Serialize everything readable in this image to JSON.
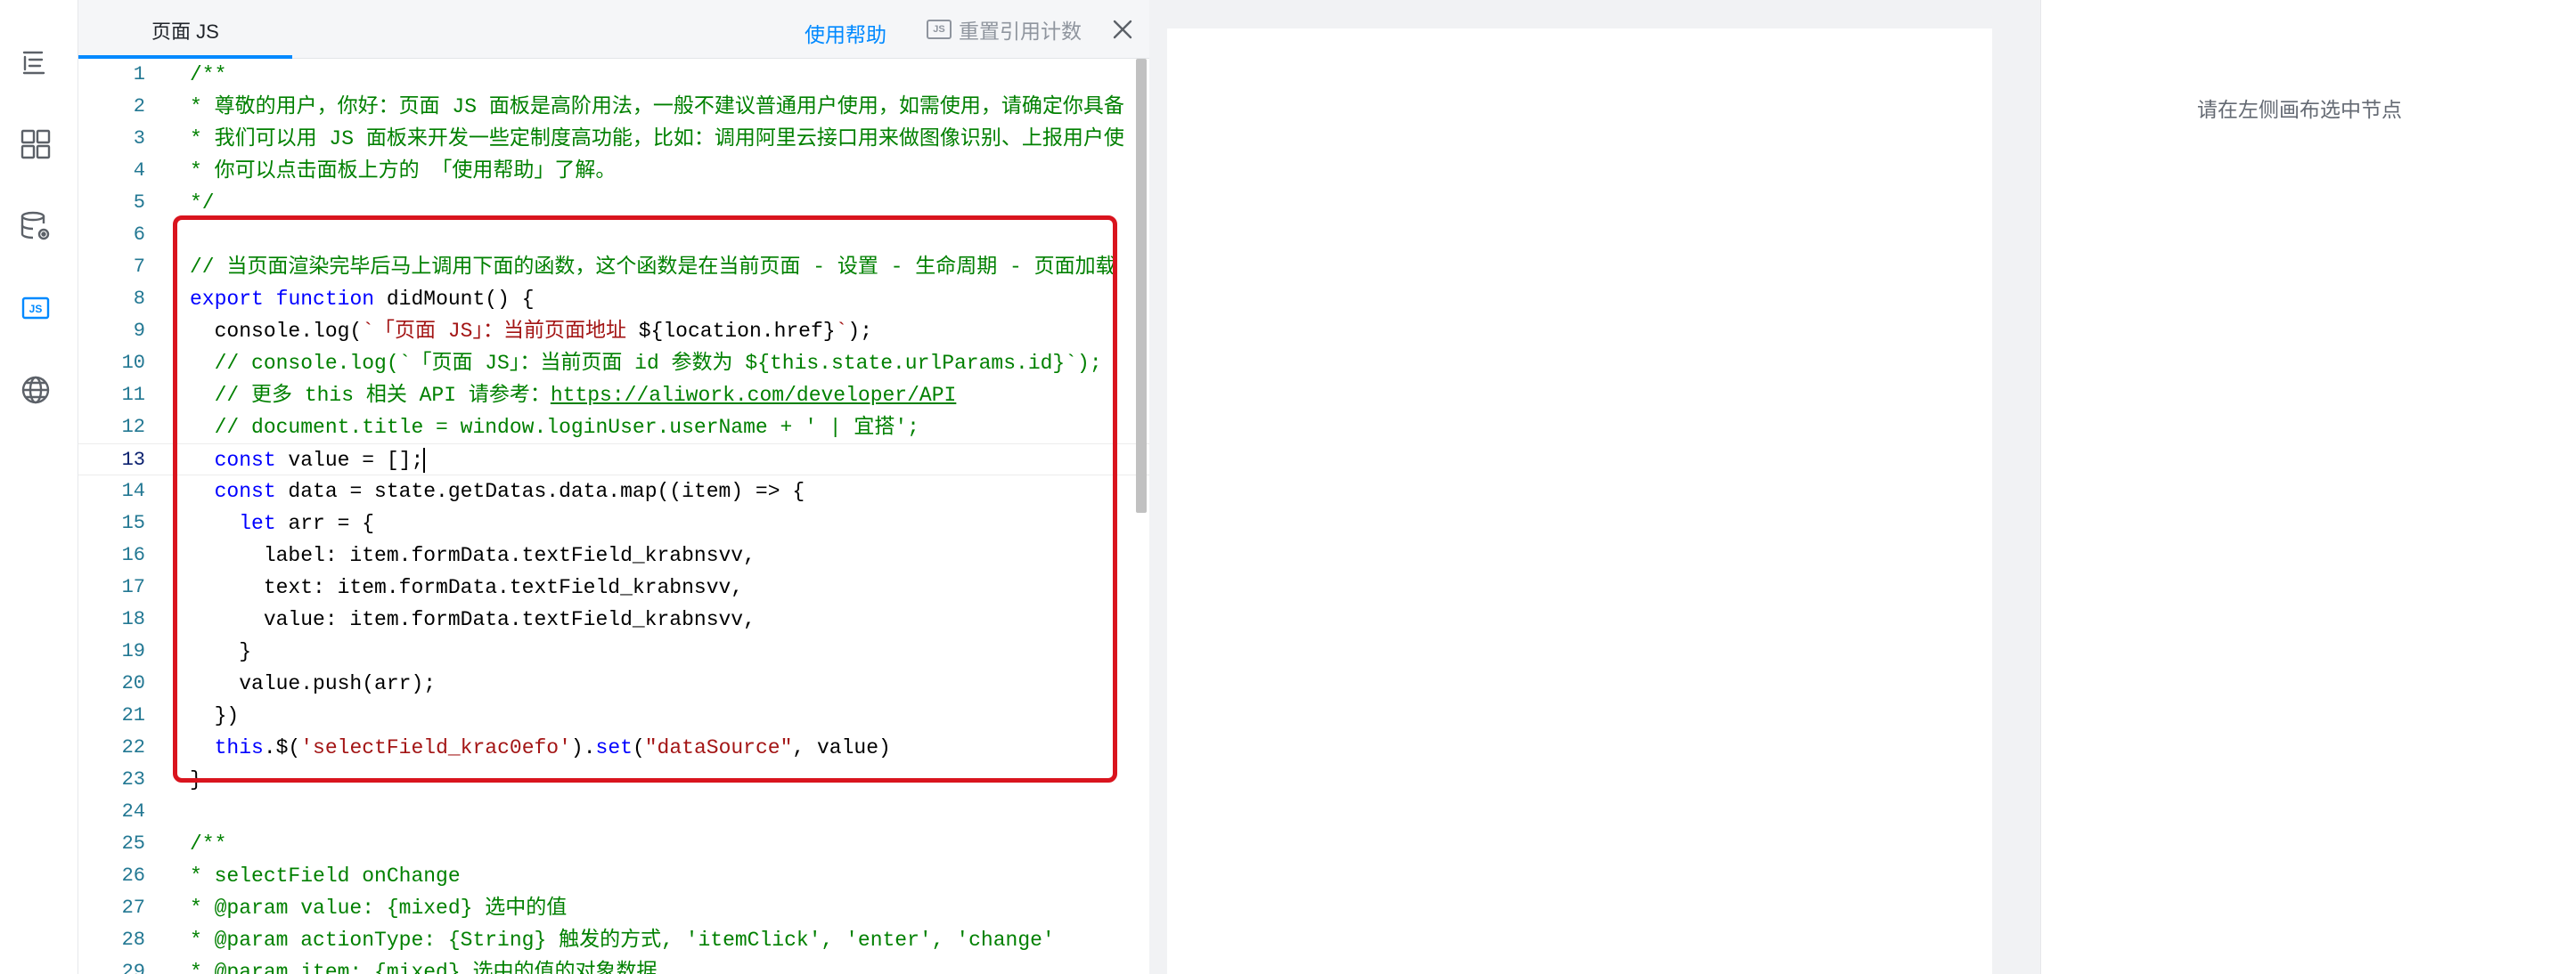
{
  "rail": {
    "icons": [
      "outline-icon",
      "components-icon",
      "datasource-icon",
      "js-icon",
      "globe-icon"
    ],
    "js_label": "JS",
    "accent": "#0089ff"
  },
  "panel": {
    "tab_label": "页面 JS",
    "help_link": "使用帮助",
    "reset_label": "重置引用计数",
    "reset_badge": "JS"
  },
  "editor": {
    "current_line": 13,
    "lines": [
      {
        "n": "1",
        "html": "<span class=\"c\">/**</span>"
      },
      {
        "n": "2",
        "html": "<span class=\"c\">* 尊敬的用户，你好：页面 JS 面板是高阶用法，一般不建议普通用户使用，如需使用，请确定你具备</span>"
      },
      {
        "n": "3",
        "html": "<span class=\"c\">* 我们可以用 JS 面板来开发一些定制度高功能，比如：调用阿里云接口用来做图像识别、上报用户使</span>"
      },
      {
        "n": "4",
        "html": "<span class=\"c\">* 你可以点击面板上方的 「使用帮助」了解。</span>"
      },
      {
        "n": "5",
        "html": "<span class=\"c\">*/</span>"
      },
      {
        "n": "6",
        "html": ""
      },
      {
        "n": "7",
        "html": "<span class=\"c\">// 当页面渲染完毕后马上调用下面的函数，这个函数是在当前页面 - 设置 - 生命周期 - 页面加载</span>"
      },
      {
        "n": "8",
        "html": "<span class=\"k\">export</span> <span class=\"k\">function</span> didMount() {"
      },
      {
        "n": "9",
        "html": "  console.log(<span class=\"s\">`「页面 JS」：当前页面地址 </span>${location.href}<span class=\"s\">`</span>);"
      },
      {
        "n": "10",
        "html": "  <span class=\"c\">// console.log(`「页面 JS」：当前页面 id 参数为 ${this.state.urlParams.id}`);</span>"
      },
      {
        "n": "11",
        "html": "  <span class=\"c\">// 更多 this 相关 API 请参考：</span><span class=\"u\">https://aliwork.com/developer/API</span>"
      },
      {
        "n": "12",
        "html": "  <span class=\"c\">// document.title = window.loginUser.userName + ' | 宜搭';</span>"
      },
      {
        "n": "13",
        "html": "  <span class=\"k\">const</span> value = [];<span class=\"caret\"></span>"
      },
      {
        "n": "14",
        "html": "  <span class=\"k\">const</span> data = state.getDatas.data.map((item) => {"
      },
      {
        "n": "15",
        "html": "    <span class=\"k\">let</span> arr = {"
      },
      {
        "n": "16",
        "html": "      label: item.formData.textField_krabnsvv,"
      },
      {
        "n": "17",
        "html": "      text: item.formData.textField_krabnsvv,"
      },
      {
        "n": "18",
        "html": "      value: item.formData.textField_krabnsvv,"
      },
      {
        "n": "19",
        "html": "    }"
      },
      {
        "n": "20",
        "html": "    value.push(arr);"
      },
      {
        "n": "21",
        "html": "  })"
      },
      {
        "n": "22",
        "html": "  <span class=\"k\">this</span>.$(<span class=\"s\">'selectField_krac0efo'</span>).<span class=\"k\">set</span>(<span class=\"s\">\"dataSource\"</span>, value)"
      },
      {
        "n": "23",
        "html": "}"
      },
      {
        "n": "24",
        "html": ""
      },
      {
        "n": "25",
        "html": "<span class=\"c\">/**</span>"
      },
      {
        "n": "26",
        "html": "<span class=\"c\">* selectField onChange</span>"
      },
      {
        "n": "27",
        "html": "<span class=\"c\">* @param value: {mixed} 选中的值</span>"
      },
      {
        "n": "28",
        "html": "<span class=\"c\">* @param actionType: {String} 触发的方式, 'itemClick', 'enter', 'change'</span>"
      },
      {
        "n": "29",
        "html": "<span class=\"c\">* @param item: {mixed} 选中的值的对象数据</span>"
      }
    ]
  },
  "settings": {
    "empty_text": "请在左侧画布选中节点"
  }
}
